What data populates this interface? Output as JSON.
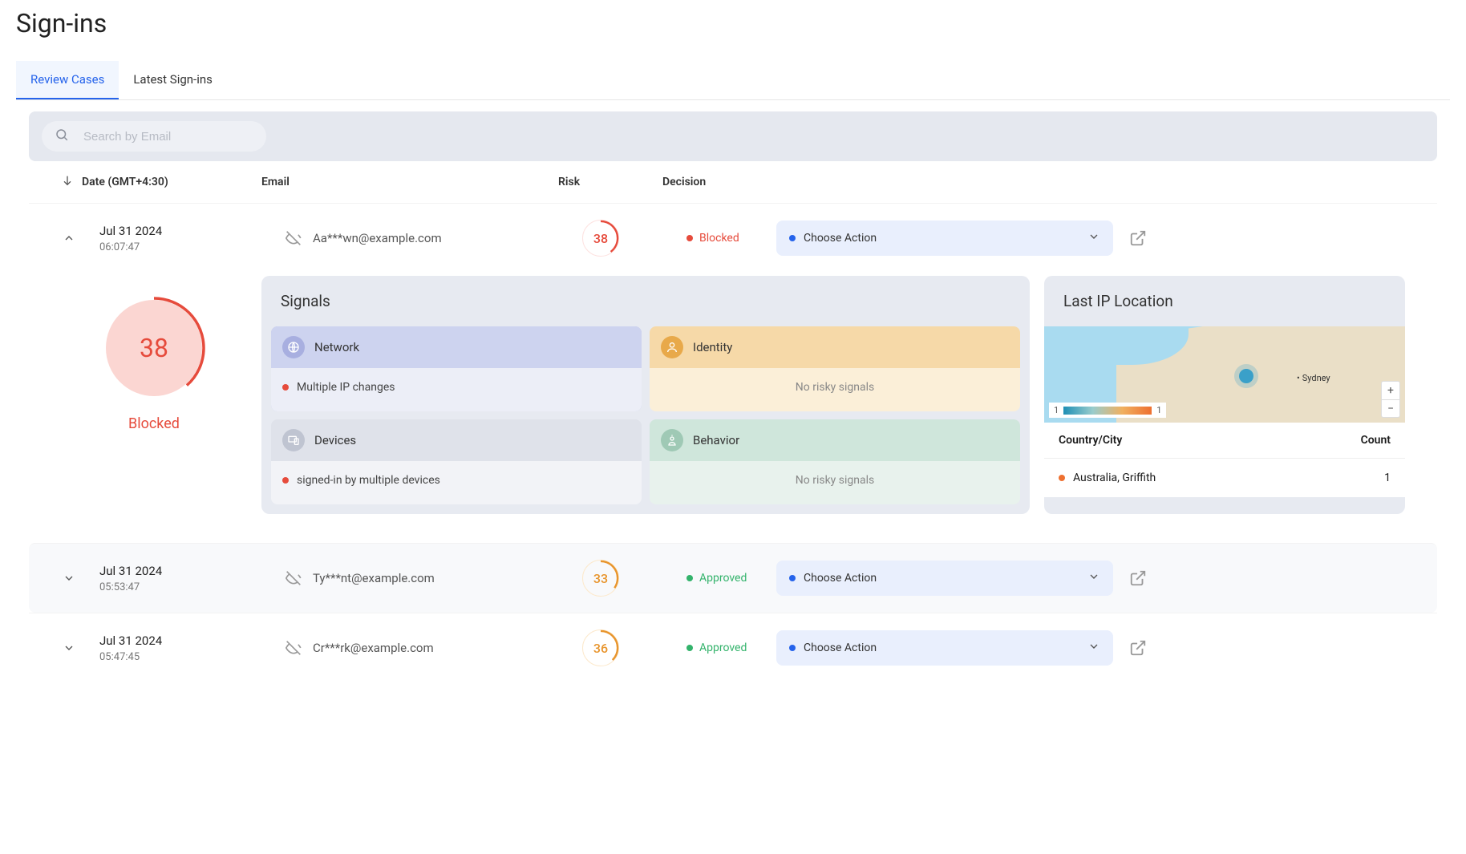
{
  "page_title": "Sign-ins",
  "tabs": {
    "review": "Review Cases",
    "latest": "Latest Sign-ins"
  },
  "search": {
    "placeholder": "Search by Email"
  },
  "columns": {
    "date": "Date (GMT+4:30)",
    "email": "Email",
    "risk": "Risk",
    "decision": "Decision"
  },
  "action_label": "Choose Action",
  "expanded": {
    "date": "Jul 31 2024",
    "time": "06:07:47",
    "email": "Aa***wn@example.com",
    "risk": "38",
    "decision": "Blocked",
    "big_score": "38",
    "big_label": "Blocked",
    "signals_title": "Signals",
    "network": {
      "title": "Network",
      "item": "Multiple IP changes"
    },
    "identity": {
      "title": "Identity",
      "msg": "No risky signals"
    },
    "devices": {
      "title": "Devices",
      "item": "signed-in by multiple devices"
    },
    "behavior": {
      "title": "Behavior",
      "msg": "No risky signals"
    },
    "ip_title": "Last IP Location",
    "map_city": "Sydney",
    "legend_min": "1",
    "legend_max": "1",
    "ip_head_country": "Country/City",
    "ip_head_count": "Count",
    "ip_row_country": "Australia, Griffith",
    "ip_row_count": "1"
  },
  "rows": [
    {
      "date": "Jul 31 2024",
      "time": "05:53:47",
      "email": "Ty***nt@example.com",
      "risk": "33",
      "decision": "Approved"
    },
    {
      "date": "Jul 31 2024",
      "time": "05:47:45",
      "email": "Cr***rk@example.com",
      "risk": "36",
      "decision": "Approved"
    }
  ]
}
